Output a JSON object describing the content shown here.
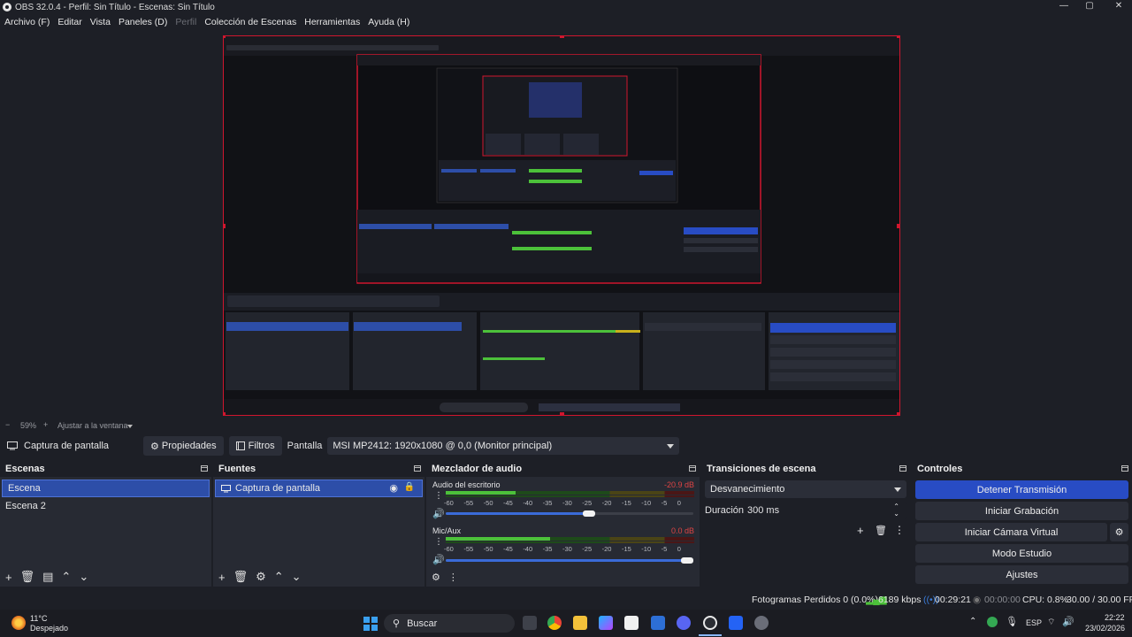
{
  "window": {
    "title": "OBS 32.0.4 - Perfil: Sin Título - Escenas: Sin Título",
    "minimize": "—",
    "maximize": "▢",
    "close": "✕"
  },
  "menu": {
    "items": [
      "Archivo (F)",
      "Editar",
      "Vista",
      "Paneles (D)",
      "Perfil",
      "Colección de Escenas",
      "Herramientas",
      "Ayuda (H)"
    ]
  },
  "zoom": {
    "level": "59%",
    "fit_label": "Ajustar a la ventana"
  },
  "source_toolbar": {
    "source_name": "Captura de pantalla",
    "properties_label": "Propiedades",
    "filters_label": "Filtros",
    "display_label": "Pantalla",
    "display_value": "MSI MP2412: 1920x1080 @ 0,0 (Monitor principal)"
  },
  "scenes": {
    "title": "Escenas",
    "items": [
      "Escena",
      "Escena 2"
    ]
  },
  "sources": {
    "title": "Fuentes",
    "items": [
      "Captura de pantalla"
    ]
  },
  "mixer": {
    "title": "Mezclador de audio",
    "channels": [
      {
        "name": "Audio del escritorio",
        "db": "-20.9 dB",
        "level": 0.28,
        "volume": 0.58
      },
      {
        "name": "Mic/Aux",
        "db": "0.0 dB",
        "level": 0.42,
        "volume": 1.0
      }
    ],
    "ticks": [
      "-60",
      "-55",
      "-50",
      "-45",
      "-40",
      "-35",
      "-30",
      "-25",
      "-20",
      "-15",
      "-10",
      "-5",
      "0"
    ]
  },
  "transitions": {
    "title": "Transiciones de escena",
    "selected": "Desvanecimiento",
    "duration_label": "Duración",
    "duration_value": "300 ms"
  },
  "controls": {
    "title": "Controles",
    "stop_stream": "Detener Transmisión",
    "start_recording": "Iniciar Grabación",
    "start_virtual_cam": "Iniciar Cámara Virtual",
    "studio_mode": "Modo Estudio",
    "settings": "Ajustes"
  },
  "status": {
    "dropped_frames": "Fotogramas Perdidos 0 (0.0%)",
    "bitrate": "6189 kbps",
    "stream_time": "00:29:21",
    "rec_time": "00:00:00",
    "cpu": "CPU: 0.8%",
    "fps": "30.00 / 30.00 FPS"
  },
  "taskbar": {
    "weather_temp": "11°C",
    "weather_desc": "Despejado",
    "search_label": "Buscar",
    "language": "ESP",
    "time": "22:22",
    "date": "23/02/2026"
  },
  "colors": {
    "accent": "#284cc4",
    "selection": "#2d4ea8",
    "preview_border": "#d0162e",
    "background": "#1d1f26",
    "panel": "#272a33",
    "meter_green": "#4cc13a",
    "meter_yellow": "#c9b11c",
    "meter_red": "#c22a2a"
  }
}
